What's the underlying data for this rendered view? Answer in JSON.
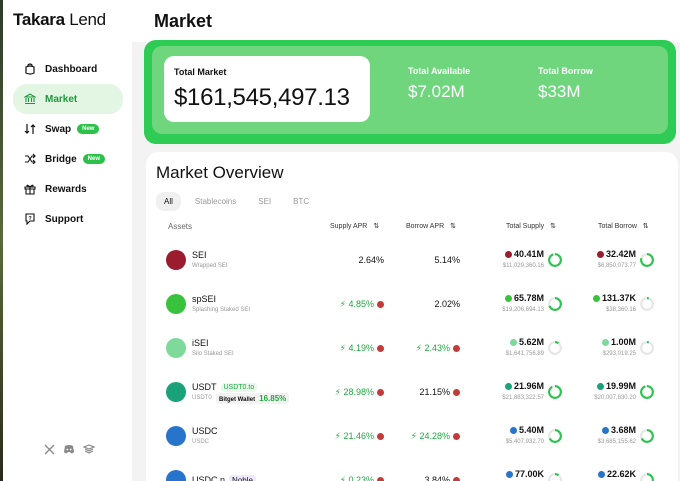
{
  "app": {
    "logo_bold": "Takara",
    "logo_light": " Lend"
  },
  "nav": [
    {
      "label": "Dashboard",
      "icon": "bag-icon"
    },
    {
      "label": "Market",
      "icon": "bank-icon",
      "active": true
    },
    {
      "label": "Swap",
      "icon": "swap-icon",
      "badge": "New"
    },
    {
      "label": "Bridge",
      "icon": "shuffle-icon",
      "badge": "New"
    },
    {
      "label": "Rewards",
      "icon": "gift-icon"
    },
    {
      "label": "Support",
      "icon": "help-icon"
    }
  ],
  "socials": [
    "x-icon",
    "discord-icon",
    "docs-icon"
  ],
  "page": {
    "title": "Market"
  },
  "banner": {
    "total_market_label": "Total Market",
    "total_market_value": "$161,545,497.13",
    "total_available_label": "Total Available",
    "total_available_value": "$7.02M",
    "total_borrow_label": "Total Borrow",
    "total_borrow_value": "$33M"
  },
  "overview": {
    "title": "Market Overview",
    "tabs": [
      "All",
      "Stablecoins",
      "SEI",
      "BTC"
    ],
    "columns": {
      "assets": "Assets",
      "supply_apr": "Supply APR",
      "borrow_apr": "Borrow APR",
      "total_supply": "Total Supply",
      "total_borrow": "Total Borrow"
    },
    "rows": [
      {
        "name": "SEI",
        "sub": "Wrapped SEI",
        "supply_apr": "2.64%",
        "borrow_apr": "5.14%",
        "supply_amt": "40.41M",
        "supply_usd": "$11,029,360.16",
        "borrow_amt": "32.42M",
        "borrow_usd": "$6,850,073.77",
        "color": "#9b1c2e"
      },
      {
        "name": "spSEI",
        "sub": "Splashing Staked SEI",
        "supply_apr": "4.85%",
        "borrow_apr": "2.02%",
        "supply_amt": "65.78M",
        "supply_usd": "$19,206,694.13",
        "borrow_amt": "131.37K",
        "borrow_usd": "$38,360.16",
        "color": "#39c23c"
      },
      {
        "name": "iSEI",
        "sub": "Silo Staked SEI",
        "supply_apr": "4.19%",
        "borrow_apr": "2.43%",
        "supply_amt": "5.62M",
        "supply_usd": "$1,641,756.89",
        "borrow_amt": "1.00M",
        "borrow_usd": "$293,019.25",
        "color": "#7ed99a"
      },
      {
        "name": "USDT",
        "tag": "USDT0.to",
        "sub": "USDT0",
        "wallet_label": "Bitget Wallet",
        "wallet_value": "16.85%",
        "supply_apr": "28.98%",
        "borrow_apr": "21.15%",
        "supply_amt": "21.96M",
        "supply_usd": "$21,883,322.57",
        "borrow_amt": "19.99M",
        "borrow_usd": "$20,007,830.20",
        "color": "#1ba27a"
      },
      {
        "name": "USDC",
        "sub": "USDC",
        "supply_apr": "21.46%",
        "borrow_apr": "24.28%",
        "supply_amt": "5.40M",
        "supply_usd": "$5,407,932.70",
        "borrow_amt": "3.68M",
        "borrow_usd": "$3,685,155.62",
        "color": "#2775ca"
      },
      {
        "name": "USDC.n",
        "tag": "Noble",
        "sub": "",
        "supply_apr": "0.23%",
        "borrow_apr": "3.84%",
        "supply_amt": "77.00K",
        "supply_usd": "",
        "borrow_amt": "22.62K",
        "borrow_usd": "",
        "color": "#2775ca"
      }
    ]
  }
}
